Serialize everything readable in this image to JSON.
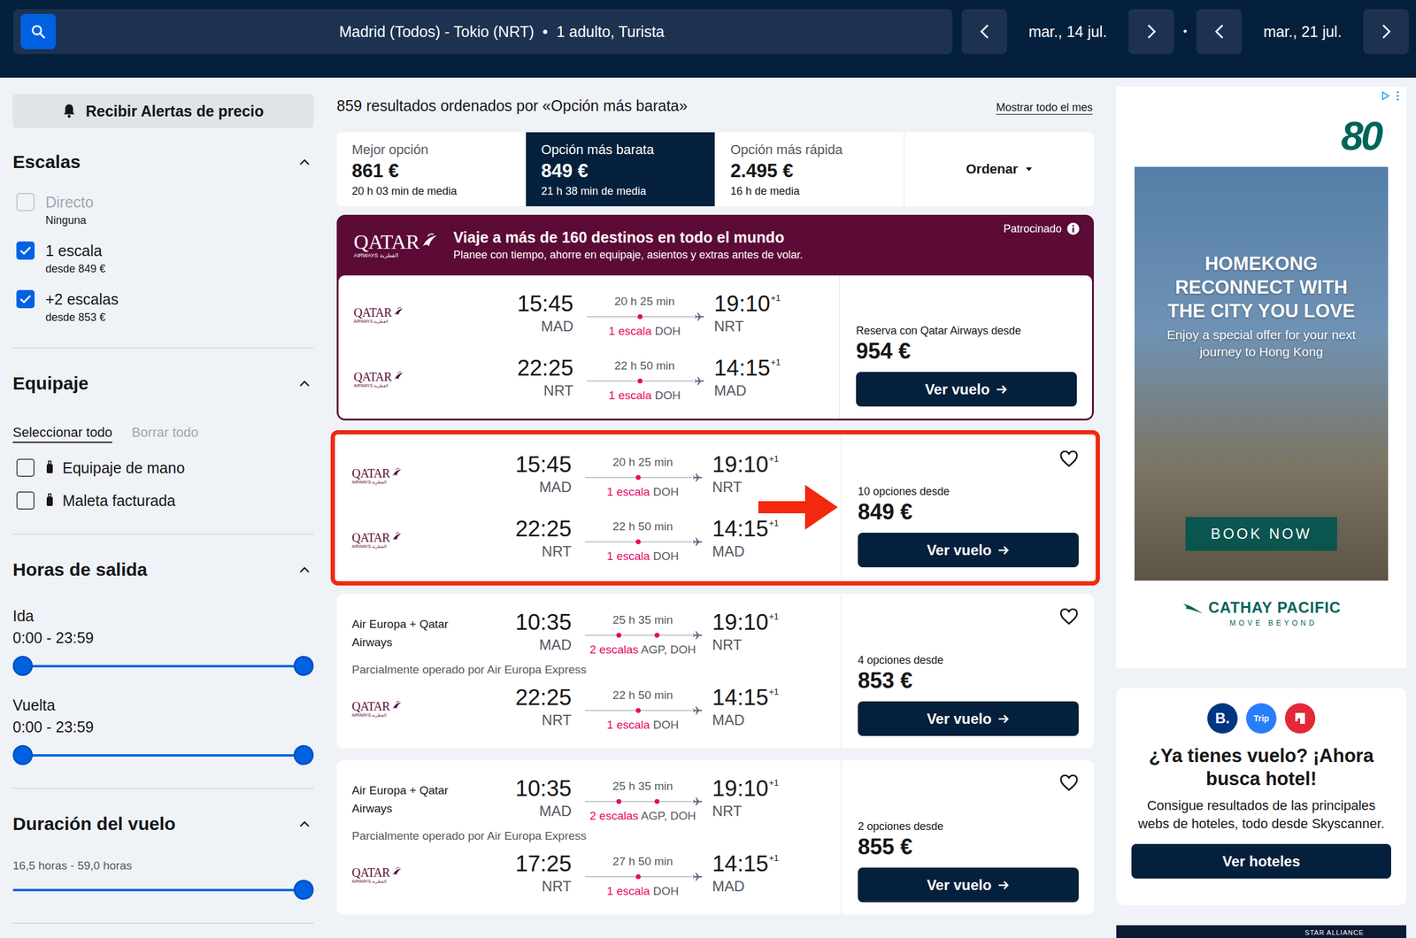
{
  "header": {
    "route": "Madrid (Todos) - Tokio (NRT)",
    "separator": "•",
    "passengers": "1 adulto, Turista",
    "depart_date": "mar., 14 jul.",
    "date_separator": "•",
    "return_date": "mar., 21 jul."
  },
  "sidebar": {
    "alert_button": "Recibir Alertas de precio",
    "stops": {
      "title": "Escalas",
      "expanded": true,
      "options": [
        {
          "label": "Directo",
          "sub": "Ninguna",
          "checked": false,
          "disabled": true
        },
        {
          "label": "1 escala",
          "sub": "desde 849 €",
          "checked": true,
          "disabled": false
        },
        {
          "label": "+2 escalas",
          "sub": "desde 853 €",
          "checked": true,
          "disabled": false
        }
      ]
    },
    "baggage": {
      "title": "Equipaje",
      "expanded": true,
      "select_all": "Seleccionar todo",
      "clear_all": "Borrar todo",
      "clear_disabled": true,
      "options": [
        {
          "label": "Equipaje de mano",
          "checked": false
        },
        {
          "label": "Maleta facturada",
          "checked": false
        }
      ]
    },
    "times": {
      "title": "Horas de salida",
      "expanded": true,
      "ranges": [
        {
          "label": "Ida",
          "value": "0:00 - 23:59",
          "low": 0,
          "high": 1
        },
        {
          "label": "Vuelta",
          "value": "0:00 - 23:59",
          "low": 0,
          "high": 1
        }
      ]
    },
    "duration": {
      "title": "Duración del vuelo",
      "expanded": true,
      "value": "16,5 horas - 59,0 horas",
      "level": 1
    }
  },
  "results_header": {
    "summary": "859 resultados ordenados por «Opción más barata»",
    "month_link": "Mostrar todo el mes"
  },
  "sort_tabs": [
    {
      "label": "Mejor opción",
      "price": "861 €",
      "sub": "20 h 03 min de media",
      "selected": false
    },
    {
      "label": "Opción más barata",
      "price": "849 €",
      "sub": "21 h 38 min de media",
      "selected": true
    },
    {
      "label": "Opción más rápida",
      "price": "2.495 €",
      "sub": "16 h de media",
      "selected": false
    }
  ],
  "sort_button": "Ordenar",
  "airline_logo": {
    "name": "QATAR",
    "sub": "AIRWAYS القطرية"
  },
  "sponsored": {
    "label": "Patrocinado",
    "title": "Viaje a más de 160 destinos en todo el mundo",
    "subtitle": "Planee con tiempo, ahorre en equipaje, asientos y extras antes de volar.",
    "price_label": "Reserva con Qatar Airways desde",
    "price": "954 €",
    "button": "Ver vuelo",
    "legs": [
      {
        "carrier": {
          "kind": "logo",
          "name": ""
        },
        "dep_time": "15:45",
        "dep_airport": "MAD",
        "duration": "20 h 25 min",
        "stops": 1,
        "stops_label": "1 escala",
        "via": "DOH",
        "arr_time": "19:10",
        "day_offset": "+1",
        "arr_airport": "NRT",
        "note": ""
      },
      {
        "carrier": {
          "kind": "logo",
          "name": ""
        },
        "dep_time": "22:25",
        "dep_airport": "NRT",
        "duration": "22 h 50 min",
        "stops": 1,
        "stops_label": "1 escala",
        "via": "DOH",
        "arr_time": "14:15",
        "day_offset": "+1",
        "arr_airport": "MAD",
        "note": ""
      }
    ]
  },
  "results": [
    {
      "highlighted": true,
      "saved": false,
      "options": "10 opciones desde",
      "price": "849 €",
      "button": "Ver vuelo",
      "legs": [
        {
          "carrier": {
            "kind": "logo",
            "name": ""
          },
          "dep_time": "15:45",
          "dep_airport": "MAD",
          "duration": "20 h 25 min",
          "stops": 1,
          "stops_label": "1 escala",
          "via": "DOH",
          "arr_time": "19:10",
          "day_offset": "+1",
          "arr_airport": "NRT",
          "note": ""
        },
        {
          "carrier": {
            "kind": "logo",
            "name": ""
          },
          "dep_time": "22:25",
          "dep_airport": "NRT",
          "duration": "22 h 50 min",
          "stops": 1,
          "stops_label": "1 escala",
          "via": "DOH",
          "arr_time": "14:15",
          "day_offset": "+1",
          "arr_airport": "MAD",
          "note": ""
        }
      ]
    },
    {
      "highlighted": false,
      "saved": false,
      "options": "4 opciones desde",
      "price": "853 €",
      "button": "Ver vuelo",
      "legs": [
        {
          "carrier": {
            "kind": "text",
            "name": "Air Europa + Qatar Airways"
          },
          "dep_time": "10:35",
          "dep_airport": "MAD",
          "duration": "25 h 35 min",
          "stops": 2,
          "stops_label": "2 escalas",
          "via": "AGP, DOH",
          "arr_time": "19:10",
          "day_offset": "+1",
          "arr_airport": "NRT",
          "note": "Parcialmente operado por Air Europa Express"
        },
        {
          "carrier": {
            "kind": "logo",
            "name": ""
          },
          "dep_time": "22:25",
          "dep_airport": "NRT",
          "duration": "22 h 50 min",
          "stops": 1,
          "stops_label": "1 escala",
          "via": "DOH",
          "arr_time": "14:15",
          "day_offset": "+1",
          "arr_airport": "MAD",
          "note": ""
        }
      ]
    },
    {
      "highlighted": false,
      "saved": false,
      "options": "2 opciones desde",
      "price": "855 €",
      "button": "Ver vuelo",
      "legs": [
        {
          "carrier": {
            "kind": "text",
            "name": "Air Europa + Qatar Airways"
          },
          "dep_time": "10:35",
          "dep_airport": "MAD",
          "duration": "25 h 35 min",
          "stops": 2,
          "stops_label": "2 escalas",
          "via": "AGP, DOH",
          "arr_time": "19:10",
          "day_offset": "+1",
          "arr_airport": "NRT",
          "note": "Parcialmente operado por Air Europa Express"
        },
        {
          "carrier": {
            "kind": "logo",
            "name": ""
          },
          "dep_time": "17:25",
          "dep_airport": "NRT",
          "duration": "27 h 50 min",
          "stops": 1,
          "stops_label": "1 escala",
          "via": "DOH",
          "arr_time": "14:15",
          "day_offset": "+1",
          "arr_airport": "MAD",
          "note": ""
        }
      ]
    }
  ],
  "ad": {
    "logo": "80",
    "headline": [
      "HOMEKONG",
      "RECONNECT WITH",
      "THE CITY YOU LOVE"
    ],
    "tagline": "Enjoy a special offer for your next journey to Hong Kong",
    "cta": "BOOK NOW",
    "brand": "CATHAY PACIFIC",
    "slogan": "MOVE BEYOND"
  },
  "hotel_promo": {
    "partners": [
      {
        "kind": "text",
        "label": "B.",
        "color": "#003580"
      },
      {
        "kind": "text",
        "label": "Trip",
        "color": "#287dfa"
      },
      {
        "kind": "icon",
        "label": "",
        "color": "#e32837"
      }
    ],
    "title": "¿Ya tienes vuelo? ¡Ahora busca hotel!",
    "body": "Consigue resultados de las principales webs de hoteles, todo desde Skyscanner.",
    "button": "Ver hoteles"
  },
  "partner_strip": "STAR ALLIANCE"
}
